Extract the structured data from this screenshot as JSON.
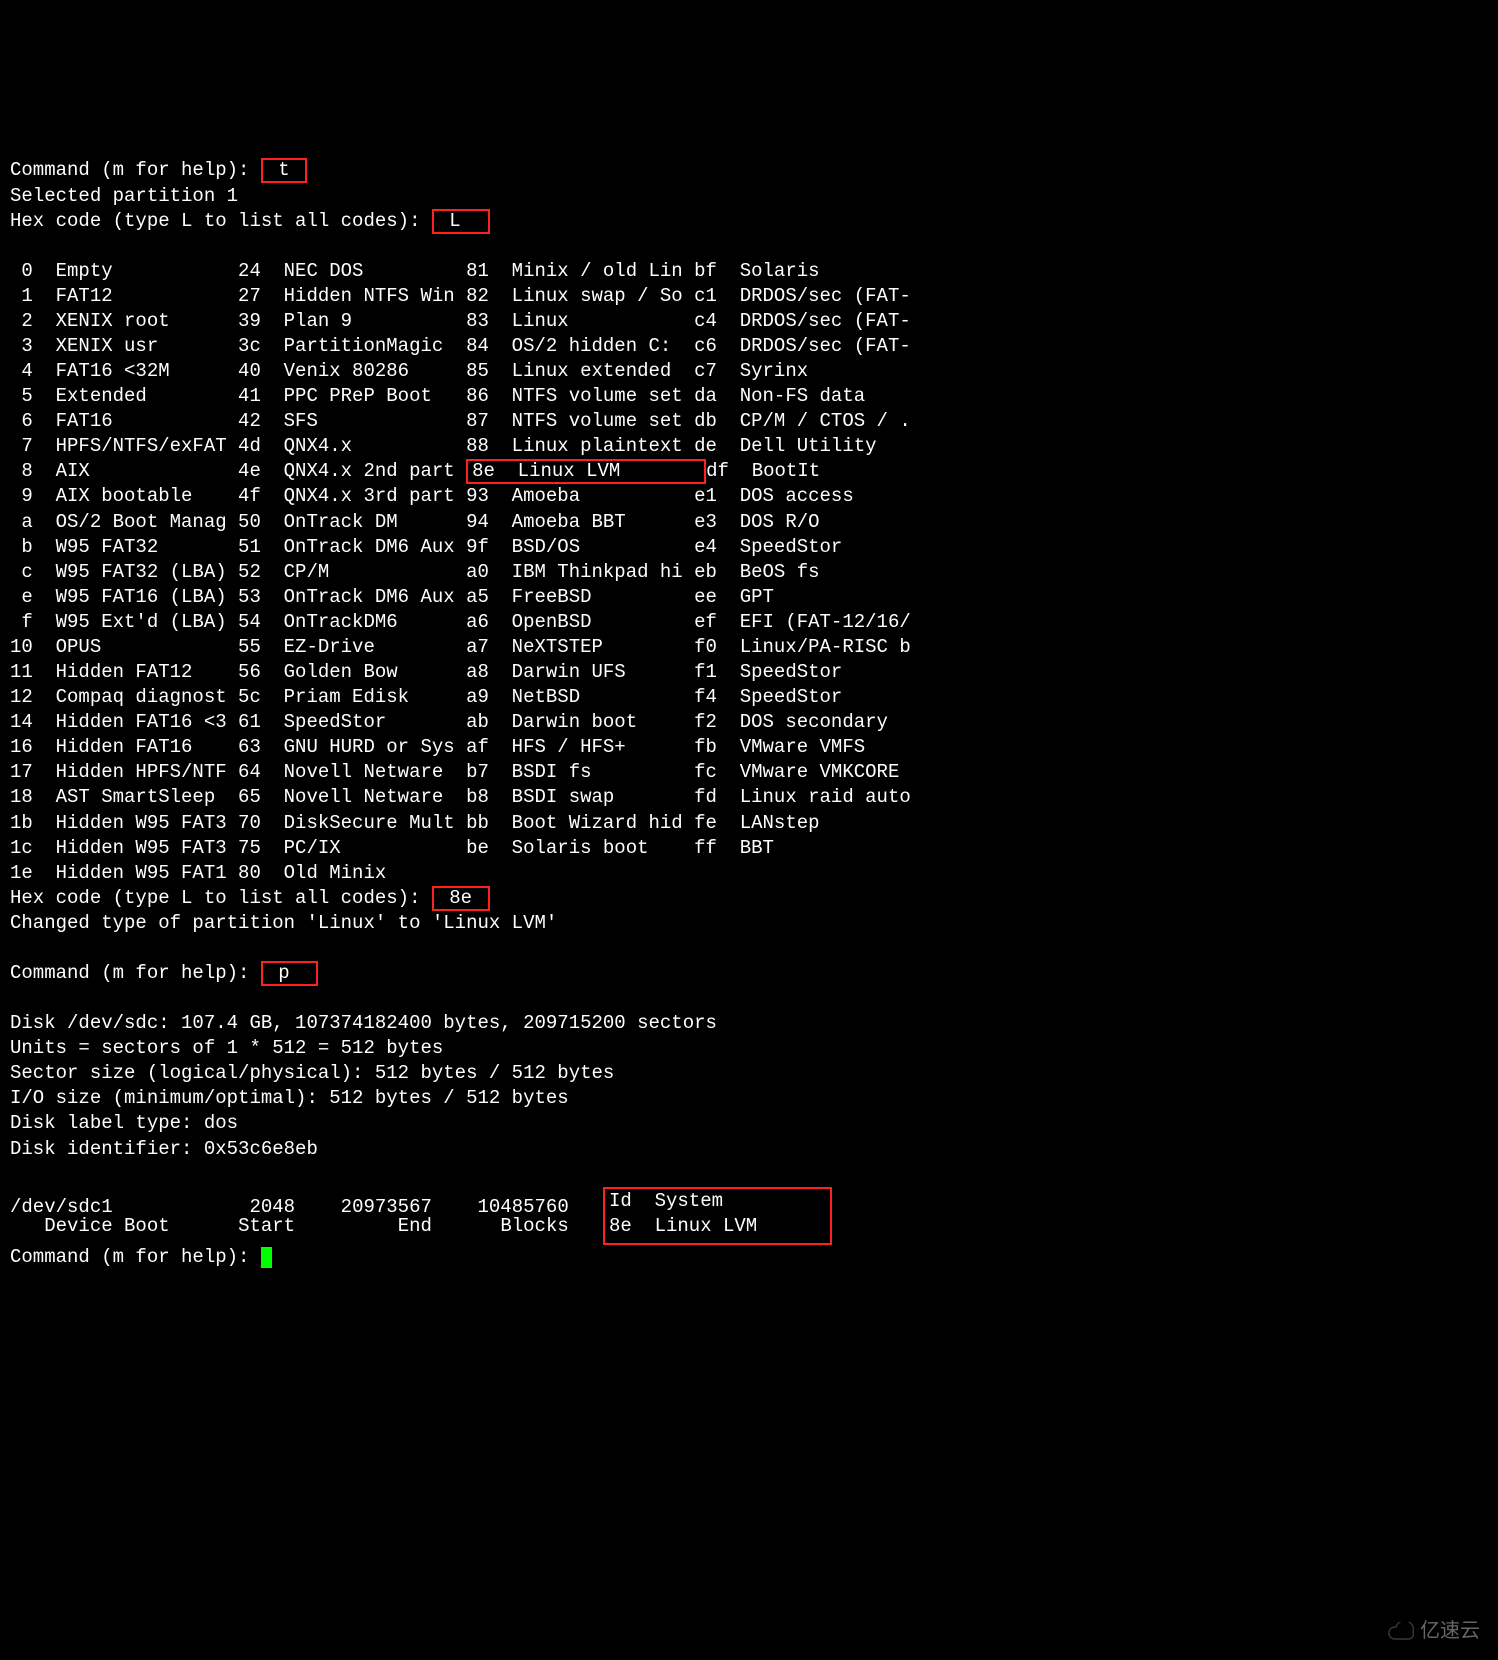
{
  "prompt_cmd": "Command (m for help): ",
  "prompt_hex": "Hex code (type L to list all codes): ",
  "input_t": "t",
  "input_L": "L",
  "input_8e": "8e",
  "input_p": "p",
  "sel_part": "Selected partition 1",
  "changed": "Changed type of partition 'Linux' to 'Linux LVM'",
  "hl_linux_lvm_code": "8e",
  "hl_linux_lvm_name": "Linux LVM",
  "disk_info": [
    "Disk /dev/sdc: 107.4 GB, 107374182400 bytes, 209715200 sectors",
    "Units = sectors of 1 * 512 = 512 bytes",
    "Sector size (logical/physical): 512 bytes / 512 bytes",
    "I/O size (minimum/optimal): 512 bytes / 512 bytes",
    "Disk label type: dos",
    "Disk identifier: 0x53c6e8eb"
  ],
  "part_header": {
    "device": "Device Boot",
    "start": "Start",
    "end": "End",
    "blocks": "Blocks",
    "id_system": "Id  System"
  },
  "part_row": {
    "device": "/dev/sdc1",
    "start": "2048",
    "end": "20973567",
    "blocks": "10485760",
    "id_system": "8e  Linux LVM"
  },
  "codes": [
    {
      "c1": " 0",
      "n1": "Empty",
      "c2": "24",
      "n2": "NEC DOS",
      "c3": "81",
      "n3": "Minix / old Lin",
      "c4": "bf",
      "n4": "Solaris"
    },
    {
      "c1": " 1",
      "n1": "FAT12",
      "c2": "27",
      "n2": "Hidden NTFS Win",
      "c3": "82",
      "n3": "Linux swap / So",
      "c4": "c1",
      "n4": "DRDOS/sec (FAT-"
    },
    {
      "c1": " 2",
      "n1": "XENIX root",
      "c2": "39",
      "n2": "Plan 9",
      "c3": "83",
      "n3": "Linux",
      "c4": "c4",
      "n4": "DRDOS/sec (FAT-"
    },
    {
      "c1": " 3",
      "n1": "XENIX usr",
      "c2": "3c",
      "n2": "PartitionMagic",
      "c3": "84",
      "n3": "OS/2 hidden C:",
      "c4": "c6",
      "n4": "DRDOS/sec (FAT-"
    },
    {
      "c1": " 4",
      "n1": "FAT16 <32M",
      "c2": "40",
      "n2": "Venix 80286",
      "c3": "85",
      "n3": "Linux extended",
      "c4": "c7",
      "n4": "Syrinx"
    },
    {
      "c1": " 5",
      "n1": "Extended",
      "c2": "41",
      "n2": "PPC PReP Boot",
      "c3": "86",
      "n3": "NTFS volume set",
      "c4": "da",
      "n4": "Non-FS data"
    },
    {
      "c1": " 6",
      "n1": "FAT16",
      "c2": "42",
      "n2": "SFS",
      "c3": "87",
      "n3": "NTFS volume set",
      "c4": "db",
      "n4": "CP/M / CTOS / ."
    },
    {
      "c1": " 7",
      "n1": "HPFS/NTFS/exFAT",
      "c2": "4d",
      "n2": "QNX4.x",
      "c3": "88",
      "n3": "Linux plaintext",
      "c4": "de",
      "n4": "Dell Utility"
    },
    {
      "c1": " 8",
      "n1": "AIX",
      "c2": "4e",
      "n2": "QNX4.x 2nd part",
      "c3": "8e",
      "n3": "Linux LVM",
      "c4": "df",
      "n4": "BootIt",
      "hl3": true
    },
    {
      "c1": " 9",
      "n1": "AIX bootable",
      "c2": "4f",
      "n2": "QNX4.x 3rd part",
      "c3": "93",
      "n3": "Amoeba",
      "c4": "e1",
      "n4": "DOS access"
    },
    {
      "c1": " a",
      "n1": "OS/2 Boot Manag",
      "c2": "50",
      "n2": "OnTrack DM",
      "c3": "94",
      "n3": "Amoeba BBT",
      "c4": "e3",
      "n4": "DOS R/O"
    },
    {
      "c1": " b",
      "n1": "W95 FAT32",
      "c2": "51",
      "n2": "OnTrack DM6 Aux",
      "c3": "9f",
      "n3": "BSD/OS",
      "c4": "e4",
      "n4": "SpeedStor"
    },
    {
      "c1": " c",
      "n1": "W95 FAT32 (LBA)",
      "c2": "52",
      "n2": "CP/M",
      "c3": "a0",
      "n3": "IBM Thinkpad hi",
      "c4": "eb",
      "n4": "BeOS fs"
    },
    {
      "c1": " e",
      "n1": "W95 FAT16 (LBA)",
      "c2": "53",
      "n2": "OnTrack DM6 Aux",
      "c3": "a5",
      "n3": "FreeBSD",
      "c4": "ee",
      "n4": "GPT"
    },
    {
      "c1": " f",
      "n1": "W95 Ext'd (LBA)",
      "c2": "54",
      "n2": "OnTrackDM6",
      "c3": "a6",
      "n3": "OpenBSD",
      "c4": "ef",
      "n4": "EFI (FAT-12/16/"
    },
    {
      "c1": "10",
      "n1": "OPUS",
      "c2": "55",
      "n2": "EZ-Drive",
      "c3": "a7",
      "n3": "NeXTSTEP",
      "c4": "f0",
      "n4": "Linux/PA-RISC b"
    },
    {
      "c1": "11",
      "n1": "Hidden FAT12",
      "c2": "56",
      "n2": "Golden Bow",
      "c3": "a8",
      "n3": "Darwin UFS",
      "c4": "f1",
      "n4": "SpeedStor"
    },
    {
      "c1": "12",
      "n1": "Compaq diagnost",
      "c2": "5c",
      "n2": "Priam Edisk",
      "c3": "a9",
      "n3": "NetBSD",
      "c4": "f4",
      "n4": "SpeedStor"
    },
    {
      "c1": "14",
      "n1": "Hidden FAT16 <3",
      "c2": "61",
      "n2": "SpeedStor",
      "c3": "ab",
      "n3": "Darwin boot",
      "c4": "f2",
      "n4": "DOS secondary"
    },
    {
      "c1": "16",
      "n1": "Hidden FAT16",
      "c2": "63",
      "n2": "GNU HURD or Sys",
      "c3": "af",
      "n3": "HFS / HFS+",
      "c4": "fb",
      "n4": "VMware VMFS"
    },
    {
      "c1": "17",
      "n1": "Hidden HPFS/NTF",
      "c2": "64",
      "n2": "Novell Netware",
      "c3": "b7",
      "n3": "BSDI fs",
      "c4": "fc",
      "n4": "VMware VMKCORE"
    },
    {
      "c1": "18",
      "n1": "AST SmartSleep",
      "c2": "65",
      "n2": "Novell Netware",
      "c3": "b8",
      "n3": "BSDI swap",
      "c4": "fd",
      "n4": "Linux raid auto"
    },
    {
      "c1": "1b",
      "n1": "Hidden W95 FAT3",
      "c2": "70",
      "n2": "DiskSecure Mult",
      "c3": "bb",
      "n3": "Boot Wizard hid",
      "c4": "fe",
      "n4": "LANstep"
    },
    {
      "c1": "1c",
      "n1": "Hidden W95 FAT3",
      "c2": "75",
      "n2": "PC/IX",
      "c3": "be",
      "n3": "Solaris boot",
      "c4": "ff",
      "n4": "BBT"
    },
    {
      "c1": "1e",
      "n1": "Hidden W95 FAT1",
      "c2": "80",
      "n2": "Old Minix"
    }
  ],
  "watermark": "亿速云"
}
